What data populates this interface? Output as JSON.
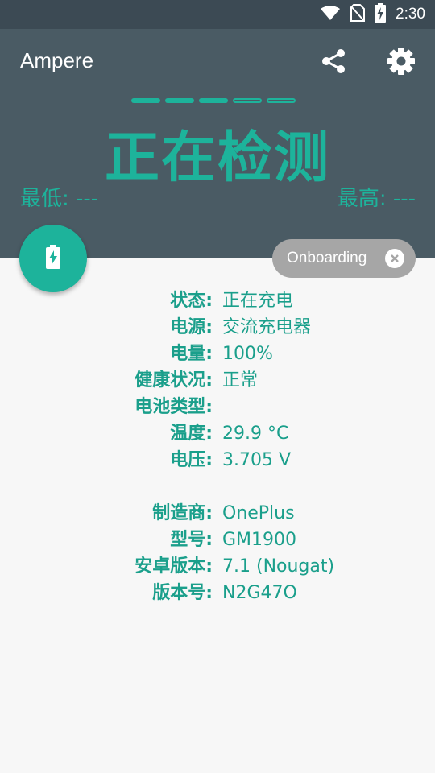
{
  "status_bar": {
    "time": "2:30",
    "icons": [
      "wifi-icon",
      "no-sim-icon",
      "battery-charging-icon"
    ]
  },
  "header": {
    "app_title": "Ampere",
    "share_icon": "share-icon",
    "settings_icon": "gear-icon",
    "progress_dots": {
      "filled": 3,
      "total": 5
    },
    "status_text": "正在检测",
    "min_text": "最低: ---",
    "max_text": "最高: ---"
  },
  "fab": {
    "icon": "battery-charging-icon"
  },
  "chip": {
    "label": "Onboarding",
    "icon": "close-circle-icon"
  },
  "battery_info": [
    {
      "label": "状态:",
      "value": "正在充电"
    },
    {
      "label": "电源:",
      "value": "交流充电器"
    },
    {
      "label": "电量:",
      "value": "100%"
    },
    {
      "label": "健康状况:",
      "value": "正常"
    },
    {
      "label": "电池类型:",
      "value": ""
    },
    {
      "label": "温度:",
      "value": "29.9 °C"
    },
    {
      "label": "电压:",
      "value": "3.705 V"
    }
  ],
  "device_info": [
    {
      "label": "制造商:",
      "value": "OnePlus"
    },
    {
      "label": "型号:",
      "value": "GM1900"
    },
    {
      "label": "安卓版本:",
      "value": "7.1 (Nougat)"
    },
    {
      "label": "版本号:",
      "value": "N2G47O"
    }
  ],
  "colors": {
    "accent": "#1db39b",
    "header": "#4a5b64",
    "statusbar": "#3c4a54",
    "chip": "#a6a6a6"
  }
}
